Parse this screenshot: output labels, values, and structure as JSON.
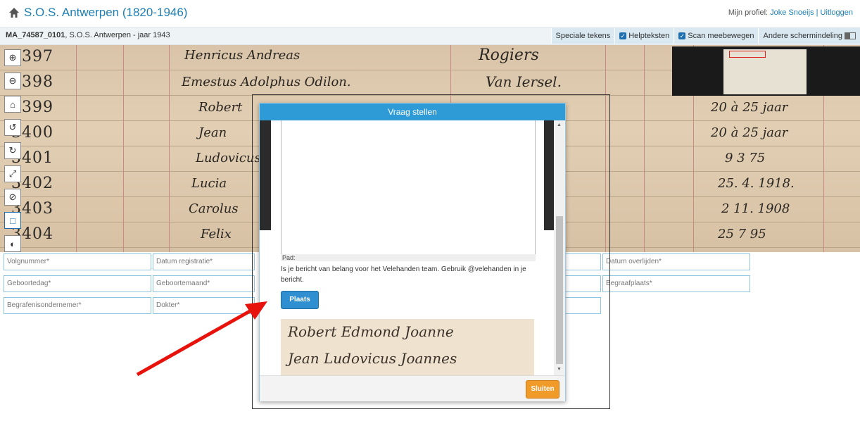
{
  "header": {
    "title": "S.O.S. Antwerpen (1820-1946)",
    "profile_label": "Mijn profiel:",
    "user_name": "Joke Snoeijs",
    "separator": "|",
    "logout": "Uitloggen"
  },
  "subbar": {
    "doc_id": "MA_74587_0101",
    "doc_title": ", S.O.S. Antwerpen - jaar 1943",
    "special_chars": "Speciale tekens",
    "helptexts": "Helpteksten",
    "scan_follow": "Scan meebewegen",
    "other_layout": "Andere schermindeling"
  },
  "scan": {
    "rows": [
      "3397",
      "3398",
      "3399",
      "3400",
      "3401",
      "3402",
      "3403",
      "3404"
    ],
    "hw_first": [
      "Henricus Andreas",
      "Emestus Adolphus Odilon.",
      "Robert",
      "Jean",
      "Ludovicus",
      "Lucia",
      "Carolus",
      "Felix"
    ],
    "hw_last": [
      "Rogiers",
      "Van Iersel."
    ],
    "hw_dates": [
      "20 à 25 jaar",
      "20 à 25 jaar",
      "9 3 75",
      "25. 4. 1918.",
      "2 11. 1908",
      "25 7 95"
    ]
  },
  "fields": [
    {
      "label": "Volgnummer*"
    },
    {
      "label": "Datum registratie*"
    },
    {
      "label": "Datum overlijden*"
    },
    {
      "label": "Geboortedag*"
    },
    {
      "label": "Geboortemaand*"
    },
    {
      "label": "Begraafplaats*"
    },
    {
      "label": "Begrafenisondernemer*"
    },
    {
      "label": "Dokter*"
    }
  ],
  "dialog": {
    "title": "Vraag stellen",
    "pad_label": "Pad:",
    "info": "Is je bericht van belang voor het Velehanden team. Gebruik @velehanden in je bericht.",
    "submit": "Plaats",
    "close": "Sluiten",
    "snippet_line1": "Robert Edmond Joanne",
    "snippet_line2": "Jean Ludovicus Joannes"
  },
  "colors": {
    "accent": "#2f9bd6",
    "close_button": "#f09a2a",
    "arrow": "#e8120c"
  }
}
